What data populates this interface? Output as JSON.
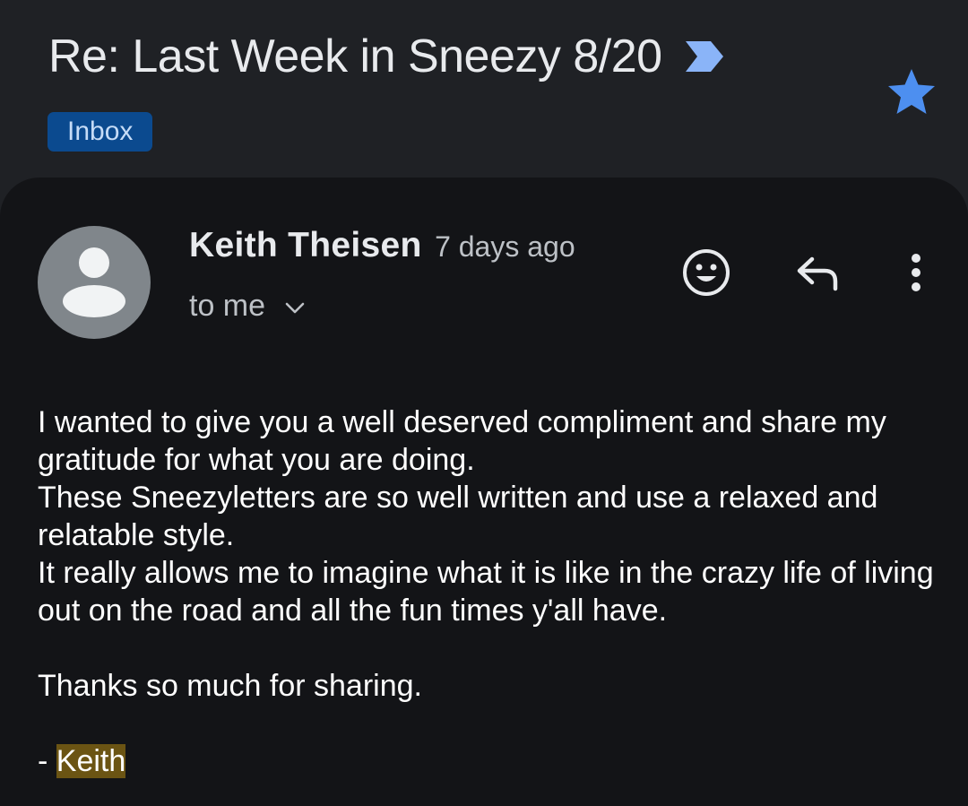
{
  "email": {
    "subject": "Re: Last Week in Sneezy 8/20",
    "label": "Inbox",
    "starred": true,
    "important_marker_color": "#8ab4f8",
    "star_color": "#4d8ff0"
  },
  "message": {
    "sender_name": "Keith Theisen",
    "timestamp": "7 days ago",
    "recipients": "to me",
    "avatar_icon": "person-avatar-icon",
    "actions": {
      "emoji_icon": "smile-emoji-icon",
      "reply_icon": "reply-arrow-icon",
      "more_icon": "vertical-dots-icon"
    },
    "body": {
      "line1": "I wanted to give you a well deserved compliment and share my gratitude for what you are doing.",
      "line2": "These Sneezyletters are so well written and use a relaxed and relatable style.",
      "line3": "It really allows me to imagine what it is like in the crazy life of living out on the road and all the fun times y'all have.",
      "thanks": "Thanks so much for sharing.",
      "signature_prefix": "- ",
      "signature_name": "Keith"
    },
    "highlight_color": "#6b5413"
  }
}
